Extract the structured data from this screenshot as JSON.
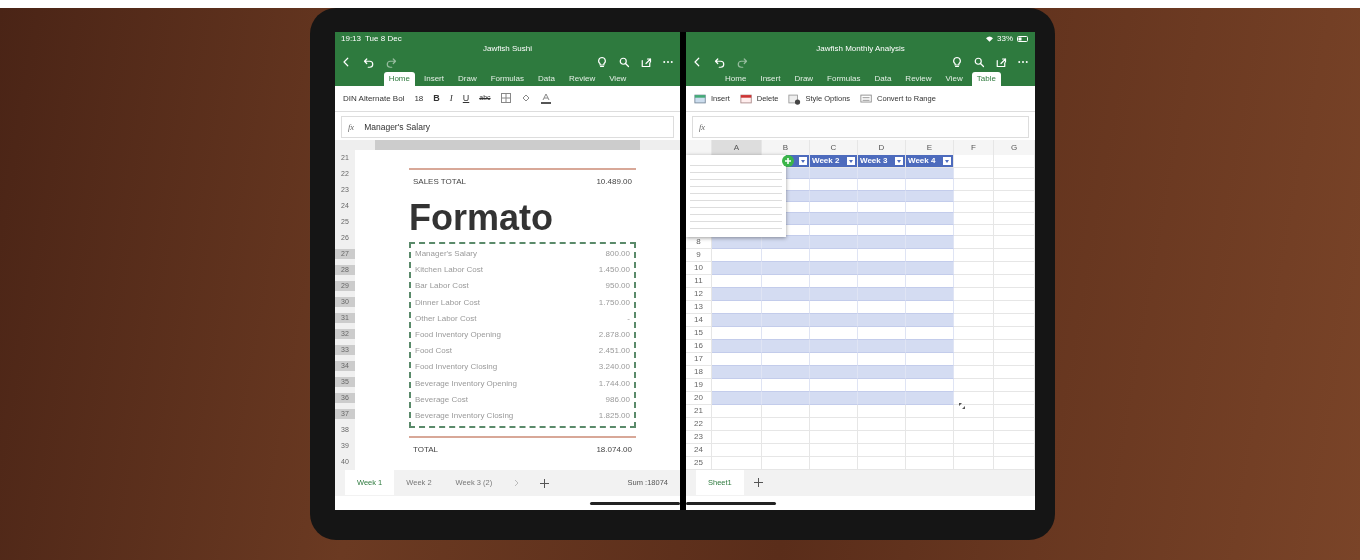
{
  "left_pane": {
    "status_time": "19:13",
    "status_date": "Tue 8 Dec",
    "title": "Jawfish Sushi",
    "tabs": [
      {
        "label": "Home",
        "selected": true
      },
      {
        "label": "Insert",
        "selected": false
      },
      {
        "label": "Draw",
        "selected": false
      },
      {
        "label": "Formulas",
        "selected": false
      },
      {
        "label": "Data",
        "selected": false
      },
      {
        "label": "Review",
        "selected": false
      },
      {
        "label": "View",
        "selected": false
      }
    ],
    "font_name": "DIN Alternate Bol",
    "font_size": "18",
    "format_buttons": [
      "B",
      "I",
      "U",
      "abc"
    ],
    "formula_label": "fx",
    "formula": "Manager's Salary",
    "row_numbers": [
      {
        "label": "21",
        "selected": false
      },
      {
        "label": "22",
        "selected": false
      },
      {
        "label": "23",
        "selected": false
      },
      {
        "label": "24",
        "selected": false
      },
      {
        "label": "25",
        "selected": false
      },
      {
        "label": "26",
        "selected": false
      },
      {
        "label": "27",
        "selected": true
      },
      {
        "label": "28",
        "selected": true
      },
      {
        "label": "29",
        "selected": true
      },
      {
        "label": "30",
        "selected": true
      },
      {
        "label": "31",
        "selected": true
      },
      {
        "label": "32",
        "selected": true
      },
      {
        "label": "33",
        "selected": true
      },
      {
        "label": "34",
        "selected": true
      },
      {
        "label": "35",
        "selected": true
      },
      {
        "label": "36",
        "selected": true
      },
      {
        "label": "37",
        "selected": true
      },
      {
        "label": "38",
        "selected": false
      },
      {
        "label": "39",
        "selected": false
      },
      {
        "label": "40",
        "selected": false
      }
    ],
    "sales_total": {
      "label": "SALES TOTAL",
      "value": "10.489.00"
    },
    "heading": "Formato",
    "items": [
      {
        "label": "Manager's Salary",
        "value": "800.00"
      },
      {
        "label": "Kitchen Labor Cost",
        "value": "1.450.00"
      },
      {
        "label": "Bar Labor Cost",
        "value": "950.00"
      },
      {
        "label": "Dinner Labor Cost",
        "value": "1.750.00"
      },
      {
        "label": "Other Labor Cost",
        "value": "-"
      },
      {
        "label": "Food Inventory Opening",
        "value": "2.878.00"
      },
      {
        "label": "Food Cost",
        "value": "2.451.00"
      },
      {
        "label": "Food Inventory Closing",
        "value": "3.240.00"
      },
      {
        "label": "Beverage Inventory Opening",
        "value": "1.744.00"
      },
      {
        "label": "Beverage Cost",
        "value": "986.00"
      },
      {
        "label": "Beverage Inventory Closing",
        "value": "1.825.00"
      }
    ],
    "total": {
      "label": "TOTAL",
      "value": "18.074.00"
    },
    "sheet_tabs": [
      {
        "label": "Week 1",
        "selected": true
      },
      {
        "label": "Week 2",
        "selected": false
      },
      {
        "label": "Week 3 (2)",
        "selected": false
      }
    ],
    "sum": "Sum :18074"
  },
  "right_pane": {
    "battery": "33%",
    "title": "Jawfish Monthly Analysis",
    "tabs": [
      {
        "label": "Home",
        "selected": false
      },
      {
        "label": "Insert",
        "selected": false
      },
      {
        "label": "Draw",
        "selected": false
      },
      {
        "label": "Formulas",
        "selected": false
      },
      {
        "label": "Data",
        "selected": false
      },
      {
        "label": "Review",
        "selected": false
      },
      {
        "label": "View",
        "selected": false
      },
      {
        "label": "Table",
        "selected": true
      }
    ],
    "formula_label": "fx",
    "ribbon_buttons": [
      {
        "label": "Insert",
        "kind": "insert"
      },
      {
        "label": "Delete",
        "kind": "delete"
      },
      {
        "label": "Style Options",
        "kind": "style"
      },
      {
        "label": "Convert to Range",
        "kind": "convert"
      }
    ],
    "columns": [
      {
        "label": "A",
        "selected": true
      },
      {
        "label": "B",
        "selected": false
      },
      {
        "label": "C",
        "selected": false
      },
      {
        "label": "D",
        "selected": false
      },
      {
        "label": "E",
        "selected": false
      },
      {
        "label": "F",
        "selected": false
      },
      {
        "label": "G",
        "selected": false
      }
    ],
    "table_headers": [
      "Week 2",
      "Week 3",
      "Week 4"
    ],
    "rows": [
      {
        "in_table": true,
        "banded": true
      },
      {
        "in_table": true,
        "banded": false
      },
      {
        "in_table": true,
        "banded": true
      },
      {
        "in_table": true,
        "banded": false
      },
      {
        "in_table": true,
        "banded": true
      },
      {
        "in_table": true,
        "banded": false
      },
      {
        "number": "8",
        "in_table": true,
        "banded": true
      },
      {
        "number": "9",
        "in_table": true,
        "banded": false
      },
      {
        "number": "10",
        "in_table": true,
        "banded": true
      },
      {
        "number": "11",
        "in_table": true,
        "banded": false
      },
      {
        "number": "12",
        "in_table": true,
        "banded": true
      },
      {
        "number": "13",
        "in_table": true,
        "banded": false
      },
      {
        "number": "14",
        "in_table": true,
        "banded": true
      },
      {
        "number": "15",
        "in_table": true,
        "banded": false
      },
      {
        "number": "16",
        "in_table": true,
        "banded": true
      },
      {
        "number": "17",
        "in_table": true,
        "banded": false
      },
      {
        "number": "18",
        "in_table": true,
        "banded": true
      },
      {
        "number": "19",
        "in_table": true,
        "banded": false
      },
      {
        "number": "20",
        "in_table": true,
        "banded": true
      },
      {
        "number": "21",
        "in_table": false
      },
      {
        "number": "22",
        "in_table": false
      },
      {
        "number": "23",
        "in_table": false
      },
      {
        "number": "24",
        "in_table": false
      },
      {
        "number": "25",
        "in_table": false
      }
    ],
    "sheet_tabs": [
      {
        "label": "Sheet1",
        "selected": true
      }
    ]
  }
}
